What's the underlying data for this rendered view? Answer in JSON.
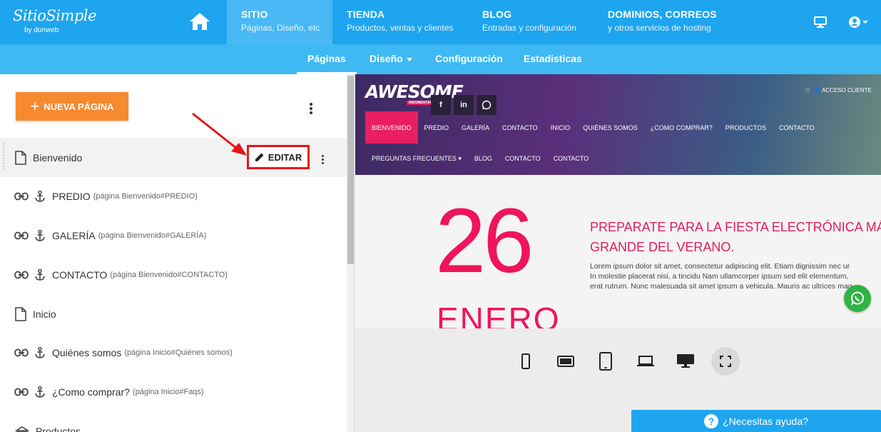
{
  "topbar": {
    "logo_name": "SitioSimple",
    "logo_sub": "by donweb",
    "nav": [
      {
        "title": "SITIO",
        "subtitle": "Páginas, Diseño, etc"
      },
      {
        "title": "TIENDA",
        "subtitle": "Productos, ventas y clientes"
      },
      {
        "title": "BLOG",
        "subtitle": "Entradas y configuración"
      },
      {
        "title": "DOMINIOS, CORREOS",
        "subtitle": "y otros servicios de hosting"
      }
    ]
  },
  "subnav": {
    "tabs": [
      "Páginas",
      "Diseño",
      "Configuración",
      "Estadisticas"
    ]
  },
  "left": {
    "new_page_label": "NUEVA PÁGINA",
    "edit_label": "EDITAR",
    "items": [
      {
        "label": "Bienvenido",
        "hint": "",
        "type": "page"
      },
      {
        "label": "PREDIO",
        "hint": "(página Bienvenido#PREDIO)",
        "type": "anchor"
      },
      {
        "label": "GALERÍA",
        "hint": "(página Bienvenido#GALERÍA)",
        "type": "anchor"
      },
      {
        "label": "CONTACTO",
        "hint": "(página Bienvenido#CONTACTO)",
        "type": "anchor"
      },
      {
        "label": "Inicio",
        "hint": "",
        "type": "page"
      },
      {
        "label": "Quiénes somos",
        "hint": "(página Inicio#Quiénes somos)",
        "type": "anchor"
      },
      {
        "label": "¿Como comprar?",
        "hint": "(página Inicio#Faqs)",
        "type": "anchor"
      },
      {
        "label": "Productos",
        "hint": "",
        "type": "store"
      }
    ]
  },
  "preview": {
    "brand": "AWESOME",
    "brand_sub": "INDUMENTARIA",
    "acceso": "ACCESO CLIENTE",
    "nav_row1": [
      "BIENVENIDO",
      "PREDIO",
      "GALERÍA",
      "CONTACTO",
      "INICIO",
      "QUIÉNES SOMOS",
      "¿COMO COMPRAR?",
      "PRODUCTOS",
      "CONTACTO"
    ],
    "nav_row2": [
      "PREGUNTAS FRECUENTES",
      "BLOG",
      "CONTACTO",
      "CONTACTO"
    ],
    "day": "26",
    "month": "ENERO",
    "headline_1": "PREPARATE PARA LA FIESTA ELECTRÓNICA MÁ",
    "headline_2": "GRANDE DEL VERANO.",
    "lorem_1": "Lorem ipsum dolor sit amet, consectetur adipiscing elit. Etiam dignissim nec ur",
    "lorem_2": "In molestie placerat nisi, a tincidu Nam ullamcorper ipsum sed elit elementum,",
    "lorem_3": "erat rutrum. Nunc malesuada sit amet ipsum a vehicula. Mauris ac ultrices mag"
  },
  "help": {
    "label": "¿Necesitas ayuda?"
  },
  "colors": {
    "primary": "#1ea5ef",
    "accent": "#f7892f",
    "highlight": "#e8141b",
    "pink": "#f0145b"
  }
}
